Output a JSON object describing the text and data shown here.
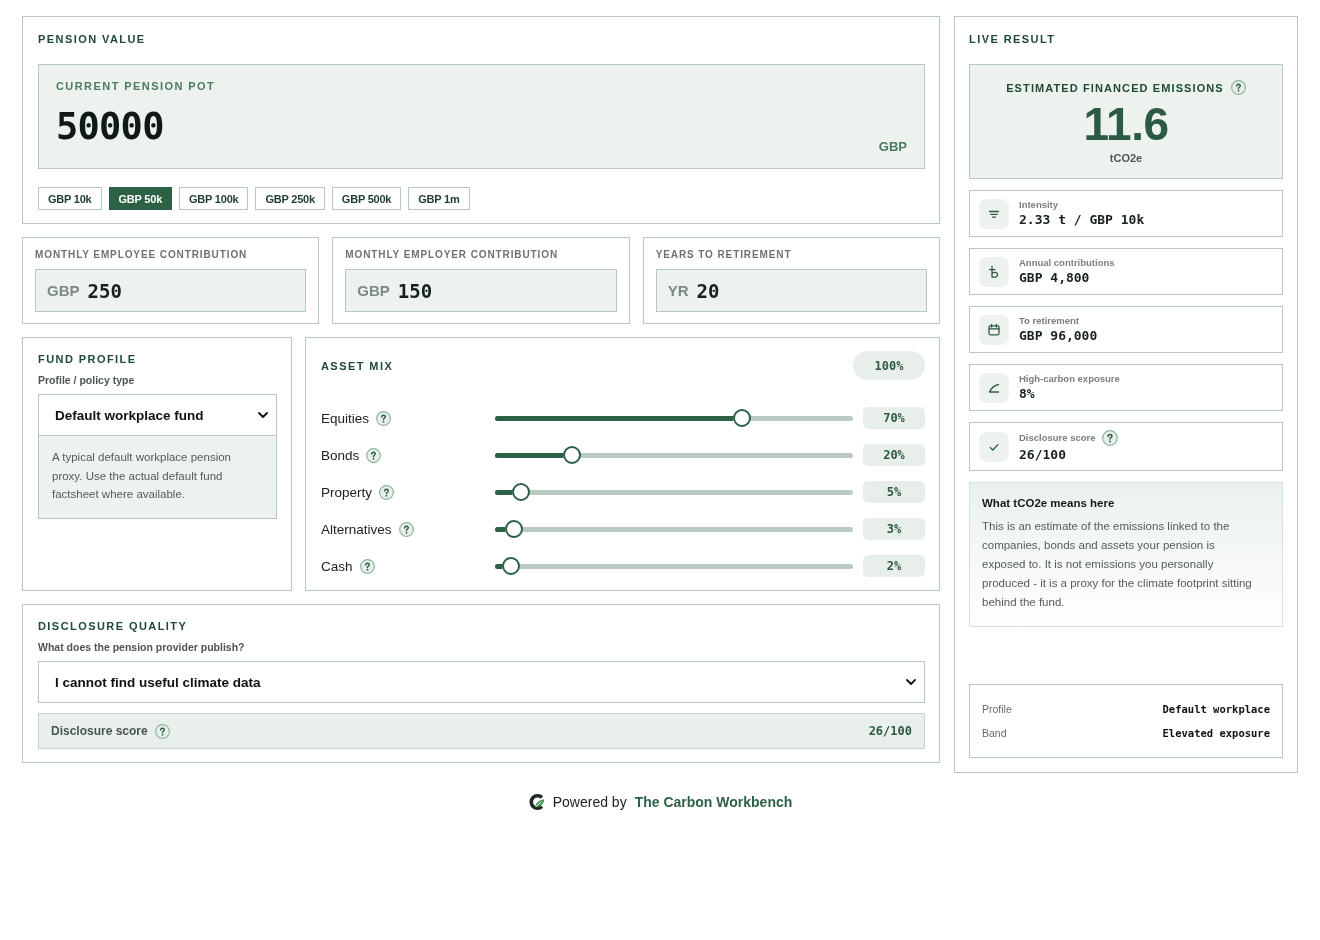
{
  "pension_value": {
    "title": "PENSION VALUE",
    "pot": {
      "label": "CURRENT PENSION POT",
      "value": "50000",
      "currency": "GBP"
    },
    "presets": [
      {
        "label": "GBP 10k",
        "selected": false
      },
      {
        "label": "GBP 50k",
        "selected": true
      },
      {
        "label": "GBP 100k",
        "selected": false
      },
      {
        "label": "GBP 250k",
        "selected": false
      },
      {
        "label": "GBP 500k",
        "selected": false
      },
      {
        "label": "GBP 1m",
        "selected": false
      }
    ]
  },
  "contributions": [
    {
      "label": "MONTHLY EMPLOYEE CONTRIBUTION",
      "unit": "GBP",
      "value": "250"
    },
    {
      "label": "MONTHLY EMPLOYER CONTRIBUTION",
      "unit": "GBP",
      "value": "150"
    },
    {
      "label": "YEARS TO RETIREMENT",
      "unit": "YR",
      "value": "20"
    }
  ],
  "fund_profile": {
    "title": "FUND PROFILE",
    "field_label": "Profile / policy type",
    "selected_option": "Default workplace fund",
    "description": "A typical default workplace pension proxy. Use the actual default fund factsheet where available."
  },
  "asset_mix": {
    "title": "ASSET MIX",
    "total": "100%",
    "assets": [
      {
        "name": "Equities",
        "level": 0.7,
        "reading": "70%"
      },
      {
        "name": "Bonds",
        "level": 0.2,
        "reading": "20%"
      },
      {
        "name": "Property",
        "level": 0.05,
        "reading": "5%"
      },
      {
        "name": "Alternatives",
        "level": 0.03,
        "reading": "3%"
      },
      {
        "name": "Cash",
        "level": 0.02,
        "reading": "2%"
      }
    ]
  },
  "disclosure_quality": {
    "title": "DISCLOSURE QUALITY",
    "question": "What does the pension provider publish?",
    "selected_option": "I cannot find useful climate data",
    "score_label": "Disclosure score",
    "score": "26/100"
  },
  "live_result": {
    "title": "LIVE RESULT",
    "headline": {
      "label": "ESTIMATED FINANCED EMISSIONS",
      "value": "11.6",
      "unit": "tCO2e"
    },
    "metrics": [
      {
        "kind": "intensity",
        "label": "Intensity",
        "value": "2.33 t / GBP 10k",
        "help": false
      },
      {
        "kind": "contributions",
        "label": "Annual contributions",
        "value": "GBP 4,800",
        "help": false
      },
      {
        "kind": "retirement",
        "label": "To retirement",
        "value": "GBP 96,000",
        "help": false
      },
      {
        "kind": "exposure",
        "label": "High-carbon exposure",
        "value": "8%",
        "help": false
      },
      {
        "kind": "disclosure",
        "label": "Disclosure score",
        "value": "26/100",
        "help": true
      }
    ],
    "explainer": {
      "title": "What tCO2e means here",
      "body": "This is an estimate of the emissions linked to the companies, bonds and assets your pension is exposed to. It is not emissions you personally produced - it is a proxy for the climate footprint sitting behind the fund."
    },
    "summary": [
      {
        "label": "Profile",
        "value": "Default workplace"
      },
      {
        "label": "Band",
        "value": "Elevated exposure"
      }
    ]
  },
  "footer": {
    "prefix": "Powered by",
    "link": "The Carbon Workbench"
  }
}
